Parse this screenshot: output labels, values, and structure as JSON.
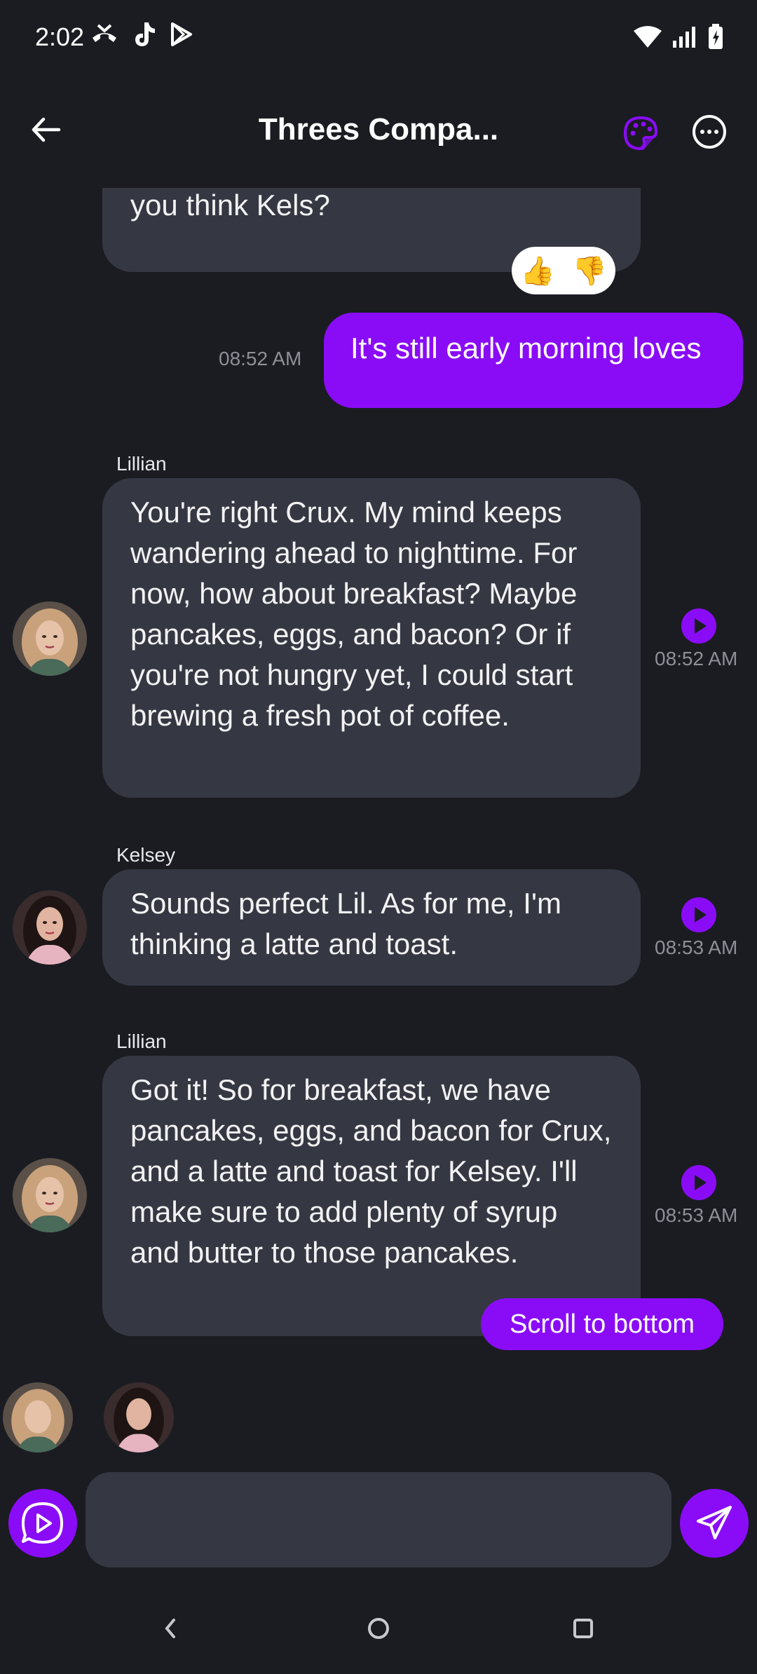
{
  "status_bar": {
    "time": "2:02"
  },
  "header": {
    "title": "Threes Compa..."
  },
  "messages": {
    "partial": {
      "text": "we listen to some music. What do you think Kels?"
    },
    "reactions": {
      "up": "👍",
      "down": "👎"
    },
    "user": {
      "text": "It's still early morning loves",
      "time": "08:52 AM"
    },
    "m1": {
      "sender": "Lillian",
      "text": "You're right Crux. My mind keeps wandering ahead to nighttime. For now, how about breakfast? Maybe pancakes, eggs, and bacon? Or if you're not hungry yet, I could start brewing a fresh pot of coffee.",
      "time": "08:52 AM"
    },
    "m2": {
      "sender": "Kelsey",
      "text": "Sounds perfect Lil. As for me, I'm thinking a latte and toast.",
      "time": "08:53 AM"
    },
    "m3": {
      "sender": "Lillian",
      "text": "Got it! So for breakfast, we have pancakes, eggs, and bacon for Crux, and a latte and toast for Kelsey. I'll make sure to add plenty of syrup and butter to those pancakes.",
      "time": "08:53 AM"
    }
  },
  "scroll_button": {
    "label": "Scroll to bottom"
  },
  "composer": {
    "placeholder": ""
  },
  "colors": {
    "accent": "#8a0cf7",
    "bubble": "#353842",
    "background": "#1b1c22"
  }
}
